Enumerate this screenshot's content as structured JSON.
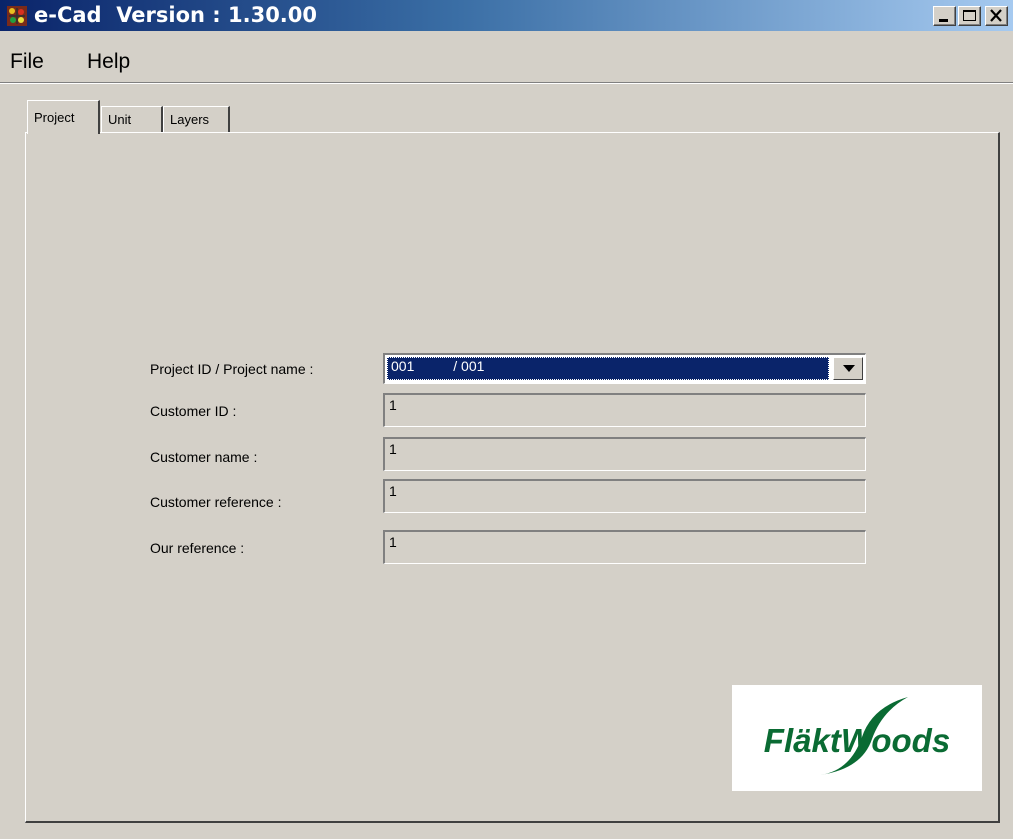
{
  "window": {
    "title": "e-Cad  Version : 1.30.00",
    "icons": [
      "app-icon",
      "minimize-icon",
      "maximize-icon",
      "close-icon"
    ]
  },
  "menu": {
    "file": "File",
    "help": "Help"
  },
  "tabs": [
    {
      "label": "Project",
      "active": true
    },
    {
      "label": "Unit",
      "active": false
    },
    {
      "label": "Layers",
      "active": false
    }
  ],
  "form": {
    "project": {
      "label": "Project ID / Project name :",
      "value": "001          / 001"
    },
    "customer_id": {
      "label": "Customer ID :",
      "value": "1"
    },
    "customer_name": {
      "label": "Customer name :",
      "value": "1"
    },
    "customer_reference": {
      "label": "Customer reference :",
      "value": "1"
    },
    "our_reference": {
      "label": "Our reference :",
      "value": "1"
    }
  },
  "logo": {
    "text": "FläktWoods",
    "color": "#0a6b33"
  },
  "colors": {
    "titlebar_start": "#0a246a",
    "titlebar_end": "#a6caf0",
    "face": "#d4d0c8",
    "selection": "#0a246a"
  }
}
